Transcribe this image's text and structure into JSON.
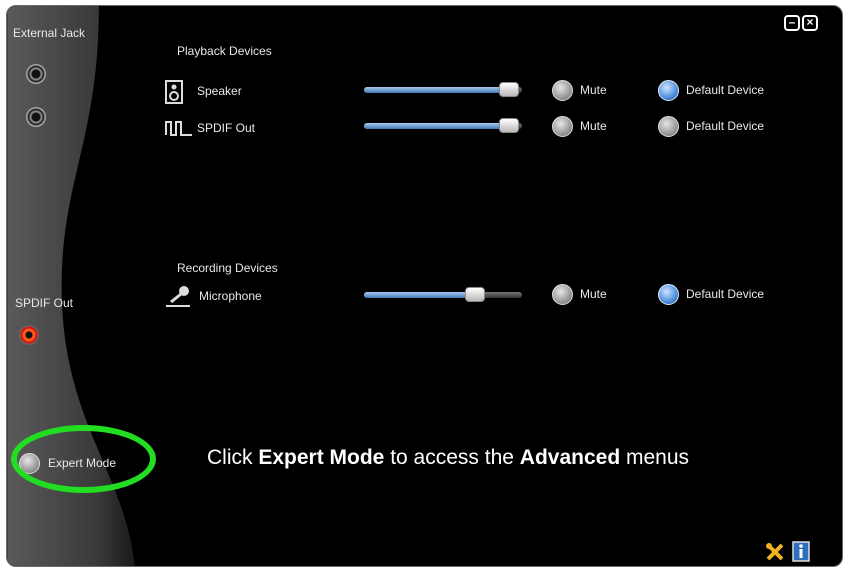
{
  "sidebar": {
    "external_jack_label": "External Jack",
    "spdif_out_label": "SPDIF Out",
    "expert_mode_label": "Expert Mode"
  },
  "playback": {
    "section_title": "Playback Devices",
    "devices": [
      {
        "name": "Speaker",
        "icon": "speaker-icon",
        "volume_fraction": 0.92,
        "mute_label": "Mute",
        "muted": false,
        "default_label": "Default Device",
        "is_default": true
      },
      {
        "name": "SPDIF Out",
        "icon": "spdif-waveform-icon",
        "volume_fraction": 0.92,
        "mute_label": "Mute",
        "muted": false,
        "default_label": "Default Device",
        "is_default": false
      }
    ]
  },
  "recording": {
    "section_title": "Recording Devices",
    "devices": [
      {
        "name": "Microphone",
        "icon": "microphone-icon",
        "volume_fraction": 0.7,
        "mute_label": "Mute",
        "muted": false,
        "default_label": "Default Device",
        "is_default": true
      }
    ]
  },
  "callout": {
    "prefix": "Click ",
    "emphasis1": "Expert Mode",
    "middle": " to access the ",
    "emphasis2": "Advanced",
    "suffix": " menus"
  },
  "colors": {
    "highlight_ring": "#22dd22",
    "slider_fill": "#5b8fd0",
    "default_radio": "#4e8fdc"
  }
}
